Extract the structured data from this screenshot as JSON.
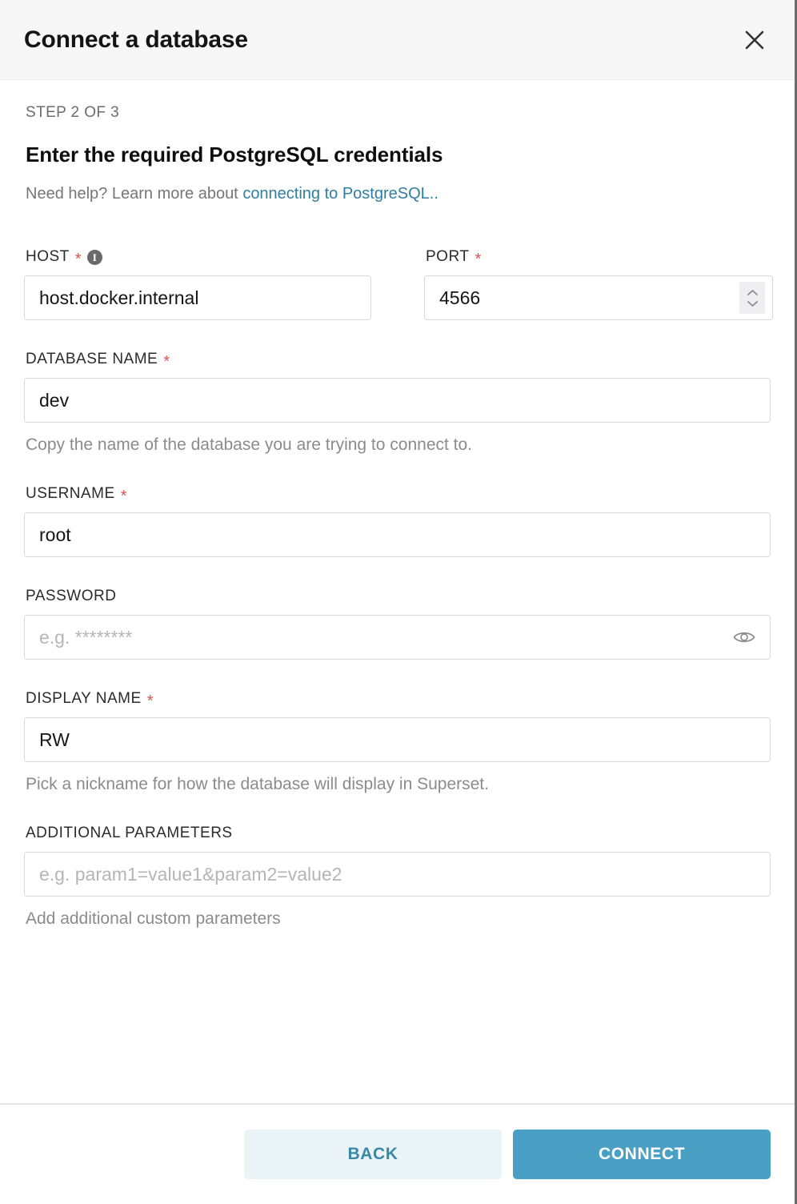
{
  "header": {
    "title": "Connect a database",
    "close_icon": "close-icon"
  },
  "body": {
    "step_label": "STEP 2 OF 3",
    "section_title": "Enter the required PostgreSQL credentials",
    "help_prefix": "Need help? Learn more about ",
    "help_link": "connecting to PostgreSQL..",
    "fields": {
      "host": {
        "label": "HOST",
        "required": "*",
        "info_icon": "info-icon",
        "value": "host.docker.internal"
      },
      "port": {
        "label": "PORT",
        "required": "*",
        "value": "4566",
        "spinner_icon": "stepper-icon"
      },
      "database_name": {
        "label": "DATABASE NAME",
        "required": "*",
        "value": "dev",
        "help": "Copy the name of the database you are trying to connect to."
      },
      "username": {
        "label": "USERNAME",
        "required": "*",
        "value": "root"
      },
      "password": {
        "label": "PASSWORD",
        "placeholder": "e.g. ********",
        "value": "",
        "eye_icon": "eye-icon"
      },
      "display_name": {
        "label": "DISPLAY NAME",
        "required": "*",
        "value": "RW",
        "help": "Pick a nickname for how the database will display in Superset."
      },
      "additional_parameters": {
        "label": "ADDITIONAL PARAMETERS",
        "placeholder": "e.g. param1=value1&param2=value2",
        "value": "",
        "help": "Add additional custom parameters"
      }
    }
  },
  "footer": {
    "back_label": "Back",
    "connect_label": "Connect"
  },
  "colors": {
    "accent": "#4aa0c4",
    "link": "#2e7ea1",
    "required": "#d9534f",
    "back_bg": "#eaf4f7",
    "header_bg": "#f7f7f7"
  }
}
